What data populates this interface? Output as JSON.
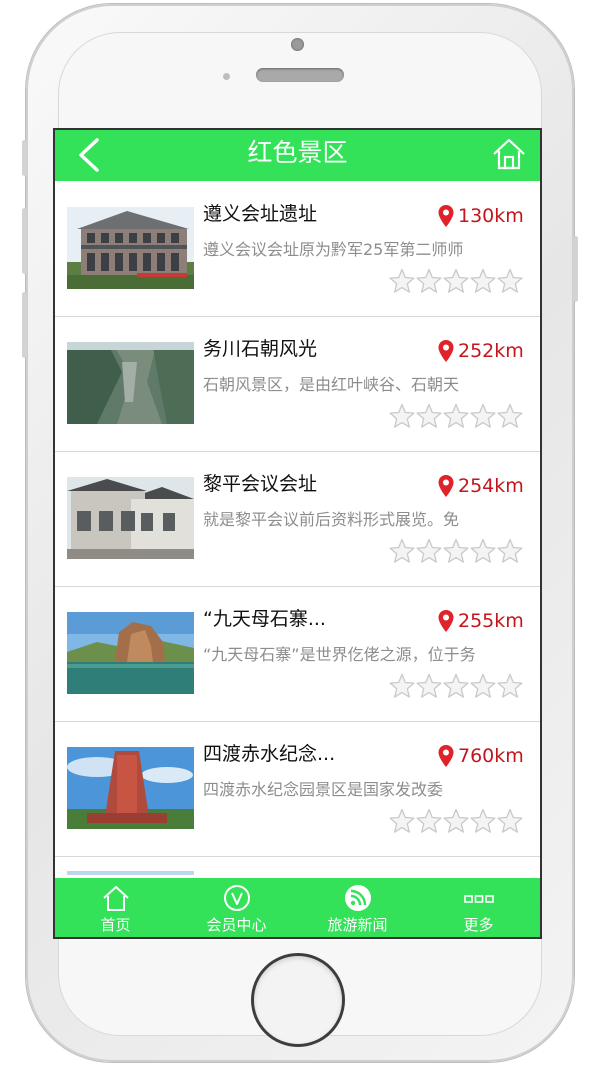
{
  "navbar": {
    "title": "红色景区"
  },
  "spots": [
    {
      "name": "遵义会址遗址",
      "distance": "130km",
      "description": "遵义会议会址原为黔军25军第二师师",
      "rating": 0
    },
    {
      "name": "务川石朝风光",
      "distance": "252km",
      "description": "石朝风景区，是由红叶峡谷、石朝天",
      "rating": 0
    },
    {
      "name": "黎平会议会址",
      "distance": "254km",
      "description": "就是黎平会议前后资料形式展览。免",
      "rating": 0
    },
    {
      "name": "“九天母石寨...",
      "distance": "255km",
      "description": "“九天母石寨”是世界仡佬之源，位于务",
      "rating": 0
    },
    {
      "name": "四渡赤水纪念...",
      "distance": "760km",
      "description": "四渡赤水纪念园景区是国家发改委",
      "rating": 0
    }
  ],
  "tabs": [
    {
      "label": "首页",
      "icon": "home-icon"
    },
    {
      "label": "会员中心",
      "icon": "vip-icon"
    },
    {
      "label": "旅游新闻",
      "icon": "rss-icon"
    },
    {
      "label": "更多",
      "icon": "more-icon"
    }
  ],
  "colors": {
    "accent": "#33e259",
    "distance": "#c4151c",
    "pin": "#e0232b"
  }
}
